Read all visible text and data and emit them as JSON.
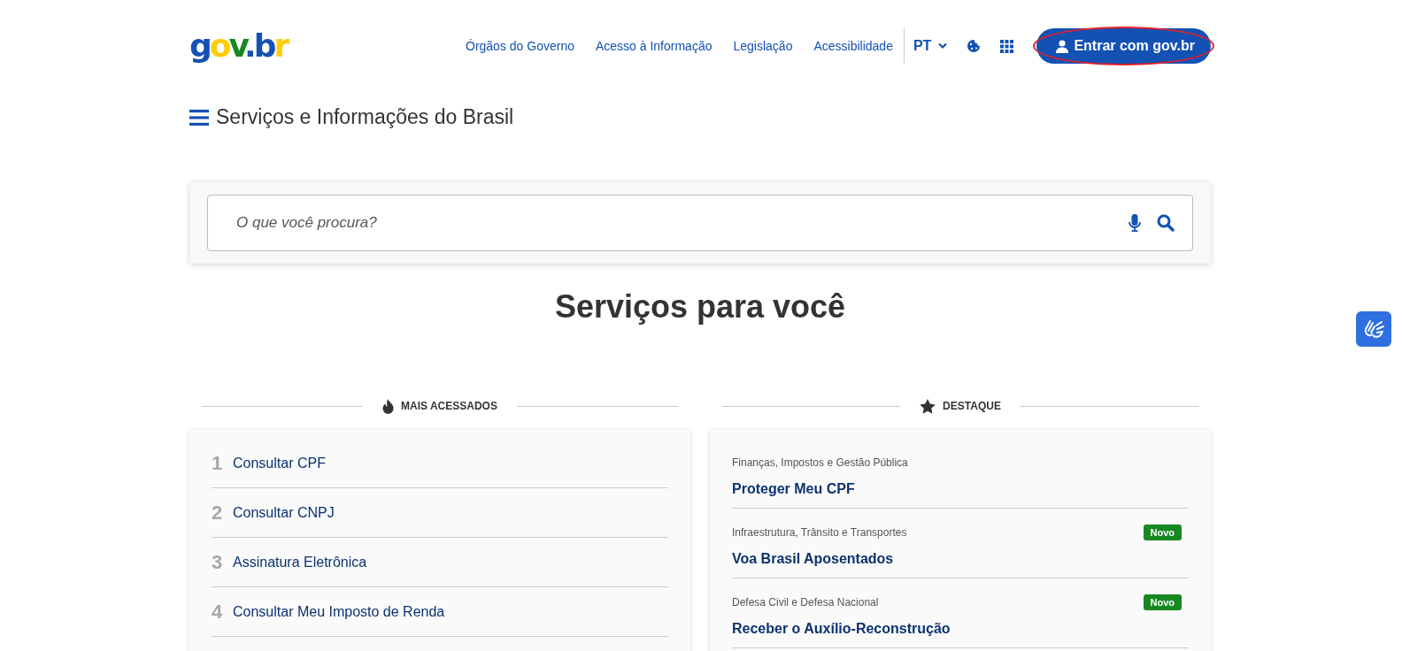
{
  "header": {
    "logo": "gov.br",
    "nav": [
      "Órgãos do Governo",
      "Acesso à Informação",
      "Legislação",
      "Acessibilidade"
    ],
    "language": "PT",
    "login_button": "Entrar com gov.br",
    "login_highlighted": true
  },
  "menu_title": "Serviços e Informações do Brasil",
  "search": {
    "placeholder": "O que você procura?"
  },
  "page_title": "Serviços para você",
  "most_accessed": {
    "heading": "MAIS ACESSADOS",
    "items": [
      {
        "rank": "1",
        "label": "Consultar CPF"
      },
      {
        "rank": "2",
        "label": "Consultar CNPJ"
      },
      {
        "rank": "3",
        "label": "Assinatura Eletrônica"
      },
      {
        "rank": "4",
        "label": "Consultar Meu Imposto de Renda"
      }
    ]
  },
  "featured": {
    "heading": "DESTAQUE",
    "items": [
      {
        "category": "Finanças, Impostos e Gestão Pública",
        "label": "Proteger Meu CPF"
      },
      {
        "category": "Infraestrutura, Trânsito e Transportes",
        "label": "Voa Brasil Aposentados",
        "badge": "Novo"
      },
      {
        "category": "Defesa Civil e Defesa Nacional",
        "label": "Receber o Auxílio-Reconstrução",
        "badge": "Novo"
      }
    ]
  }
}
